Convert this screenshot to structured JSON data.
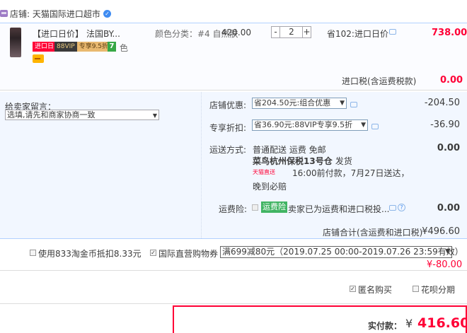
{
  "store": {
    "label": "店铺: 天猫国际进口超市"
  },
  "item": {
    "title_prefix": "【进口日价】",
    "title_brand": "法国BY...",
    "color_label": "颜色分类：#4 自然肤",
    "color_tail": "色",
    "tag_rijia": "进口日",
    "tag_vip": "88VIP",
    "tag_vip_discount": "专享9.5折",
    "tag_7": "7",
    "unit_price": "420.00",
    "quantity": "2",
    "minus_label": "-",
    "plus_label": "+",
    "savings": "省102:进口日价",
    "subtotal": "738.00"
  },
  "import_tax": {
    "label": "进口税(含运费税款)",
    "value": "0.00"
  },
  "message": {
    "label": "给卖家留言：",
    "value": "选填,请先和商家协商一致"
  },
  "fees": {
    "promo_label": "店铺优惠:",
    "promo_select": "省204.50元:组合优惠",
    "promo_amount": "-204.50",
    "member_label": "专享折扣:",
    "member_select": "省36.90元:88VIP专享9.5折",
    "member_amount": "-36.90",
    "ship_label": "运送方式:",
    "ship_line1": "普通配送 运费 免邮",
    "ship_line2_bold": "菜鸟杭州保税13号仓",
    "ship_line2_tail": "发货",
    "tmall_badge": "天猫直送",
    "ship_line3": "16:00前付款，7月27日送达，",
    "ship_line4": "晚到必赔",
    "ship_amount": "0.00",
    "ins_label": "运费险:",
    "ins_tag": "运费险",
    "ins_text": "卖家已为运费和进口税投...",
    "ins_amount": "0.00",
    "store_total_label": "店铺合计(含运费和进口税)",
    "store_total_value": "¥496.60"
  },
  "coupon": {
    "taobao_coin_label": "使用833淘金币抵扣8.33元",
    "coupon_label": "国际直营购物券",
    "coupon_select": "满699减80元（2019.07.25 00:00-2019.07.26 23:59有效）",
    "coupon_amount": "¥-80.00"
  },
  "options": {
    "anonymous_label": "匿名购买",
    "huabei_label": "花呗分期"
  },
  "payment": {
    "label": "实付款：",
    "currency": "¥",
    "amount": "416.60"
  },
  "colors": {
    "accent": "#ff0036",
    "link_blue": "#3f8cf2",
    "section_bg": "#f2f7ff"
  }
}
